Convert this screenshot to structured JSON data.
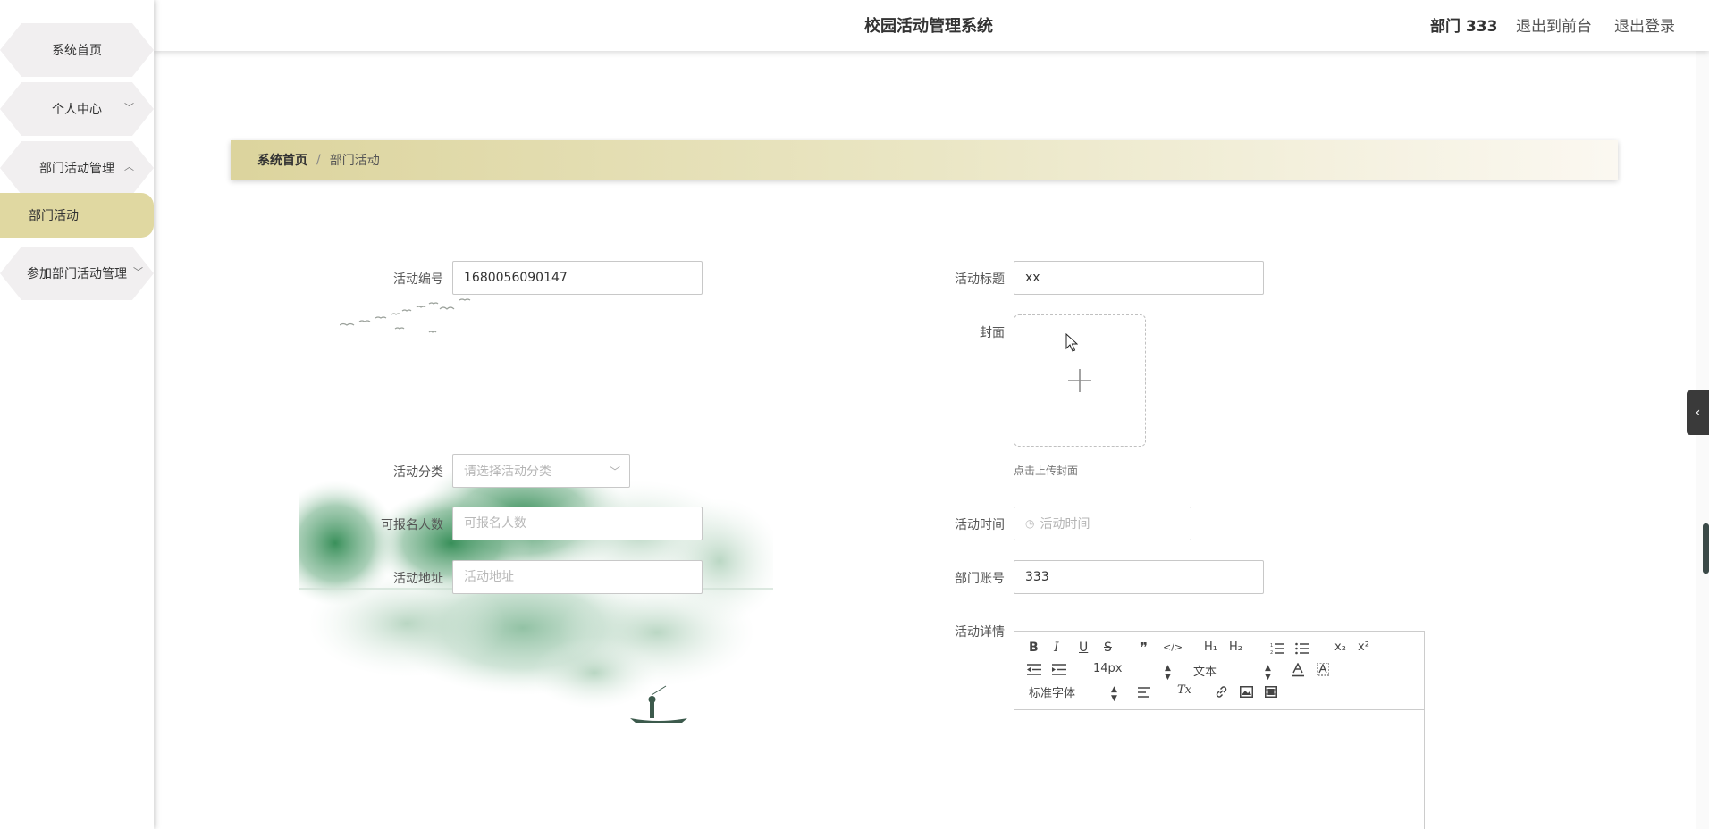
{
  "sidebar": {
    "items": [
      {
        "label": "系统首页"
      },
      {
        "label": "个人中心"
      },
      {
        "label": "部门活动管理"
      },
      {
        "label": "部门活动"
      },
      {
        "label": "参加部门活动管理"
      }
    ]
  },
  "header": {
    "title": "校园活动管理系统",
    "user": "部门 333",
    "front_link": "退出到前台",
    "logout": "退出登录"
  },
  "breadcrumb": {
    "home": "系统首页",
    "separator": "/",
    "current": "部门活动"
  },
  "form": {
    "activity_no": {
      "label": "活动编号",
      "value": "1680056090147"
    },
    "activity_title": {
      "label": "活动标题",
      "value": "xx"
    },
    "cover": {
      "label": "封面",
      "tip": "点击上传封面"
    },
    "category": {
      "label": "活动分类",
      "placeholder": "请选择活动分类"
    },
    "capacity": {
      "label": "可报名人数",
      "placeholder": "可报名人数"
    },
    "activity_time": {
      "label": "活动时间",
      "placeholder": "活动时间"
    },
    "address": {
      "label": "活动地址",
      "placeholder": "活动地址"
    },
    "dept_account": {
      "label": "部门账号",
      "value": "333"
    },
    "details": {
      "label": "活动详情"
    }
  },
  "editor": {
    "font_size": "14px",
    "heading": "文本",
    "font_family": "标准字体",
    "buttons": {
      "bold": "B",
      "italic": "I",
      "underline": "U",
      "strike": "S",
      "quote": "❞",
      "code": "</>",
      "h1": "H₁",
      "h2": "H₂",
      "sub": "x₂",
      "sup": "x²",
      "clean": "Tx"
    }
  },
  "colors": {
    "accent": "#e0d8a1",
    "breadcrumb_start": "#dcd49d",
    "sidebar_item_bg": "#f1eff0"
  }
}
